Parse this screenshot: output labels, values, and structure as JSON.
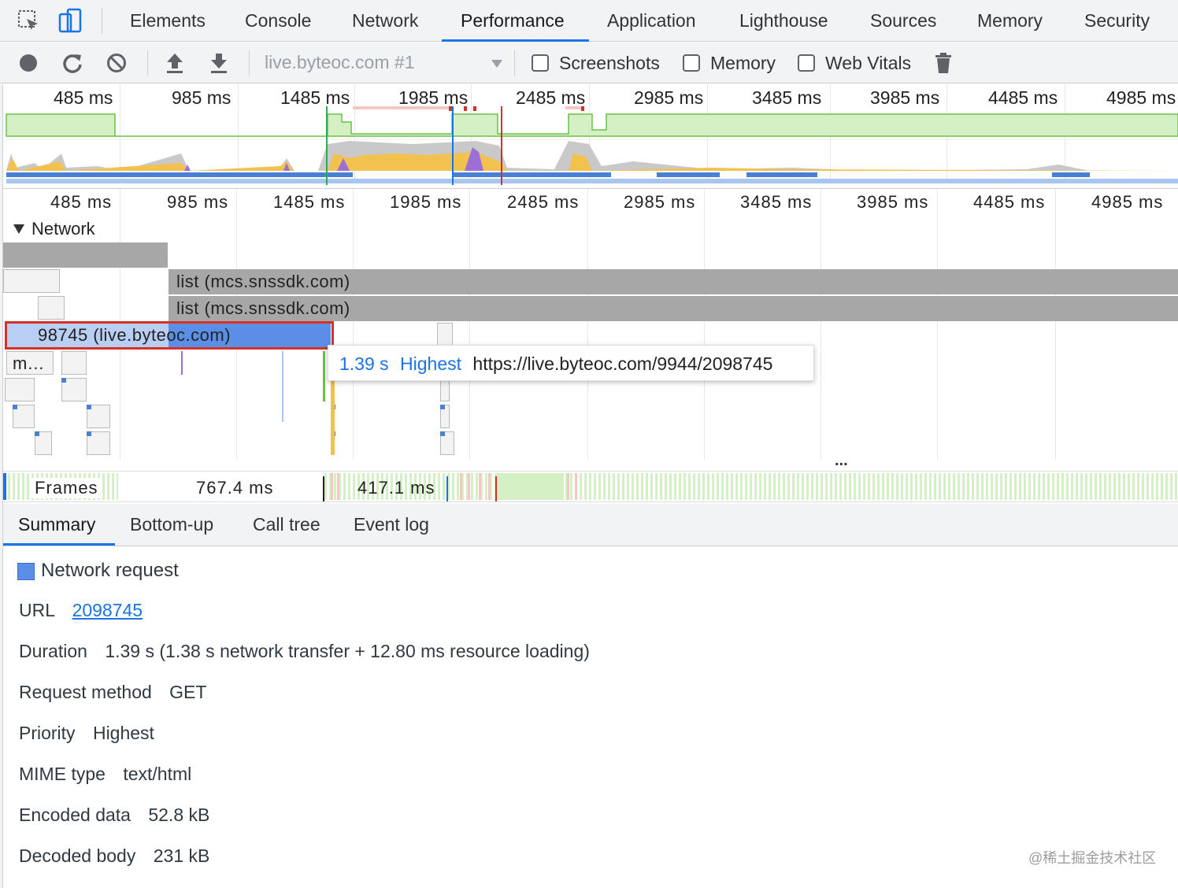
{
  "tabs": [
    {
      "label": "Elements"
    },
    {
      "label": "Console"
    },
    {
      "label": "Network"
    },
    {
      "label": "Performance"
    },
    {
      "label": "Application"
    },
    {
      "label": "Lighthouse"
    },
    {
      "label": "Sources"
    },
    {
      "label": "Memory"
    },
    {
      "label": "Security"
    }
  ],
  "toolbar": {
    "target": "live.byteoc.com #1",
    "screenshots_label": "Screenshots",
    "memory_label": "Memory",
    "web_vitals_label": "Web Vitals"
  },
  "overview_ticks": [
    "485 ms",
    "985 ms",
    "1485 ms",
    "1985 ms",
    "2485 ms",
    "2985 ms",
    "3485 ms",
    "3985 ms",
    "4485 ms",
    "4985 ms"
  ],
  "timeline_ticks": [
    "485 ms",
    "985 ms",
    "1485 ms",
    "1985 ms",
    "2485 ms",
    "2985 ms",
    "3485 ms",
    "3985 ms",
    "4485 ms",
    "4985 ms"
  ],
  "network_section": {
    "label": "Network",
    "requests": [
      {
        "label": "list (mcs.snssdk.com)"
      },
      {
        "label": "list (mcs.snssdk.com)"
      },
      {
        "label": "98745 (live.byteoc.com)"
      },
      {
        "label": "m…"
      }
    ],
    "ellipsis": "..."
  },
  "tooltip": {
    "duration": "1.39 s",
    "priority": "Highest",
    "url": "https://live.byteoc.com/9944/2098745"
  },
  "frames": {
    "label": "Frames",
    "values": [
      "767.4 ms",
      "417.1 ms"
    ]
  },
  "bottom_tabs": [
    {
      "label": "Summary"
    },
    {
      "label": "Bottom-up"
    },
    {
      "label": "Call tree"
    },
    {
      "label": "Event log"
    }
  ],
  "summary": {
    "title": "Network request",
    "rows": [
      {
        "key": "URL",
        "value": "2098745"
      },
      {
        "key": "Duration",
        "value": "1.39 s (1.38 s network transfer + 12.80 ms resource loading)"
      },
      {
        "key": "Request method",
        "value": "GET"
      },
      {
        "key": "Priority",
        "value": "Highest"
      },
      {
        "key": "MIME type",
        "value": "text/html"
      },
      {
        "key": "Encoded data",
        "value": "52.8 kB"
      },
      {
        "key": "Decoded body",
        "value": "231 kB"
      }
    ]
  },
  "watermark": "@稀土掘金技术社区",
  "colors": {
    "accent": "#1a73e8",
    "request_blue": "#5b8ee6",
    "request_gray": "#a7a7a7",
    "fps_green": "#d6f0c6",
    "highlight_red": "#d93025"
  }
}
